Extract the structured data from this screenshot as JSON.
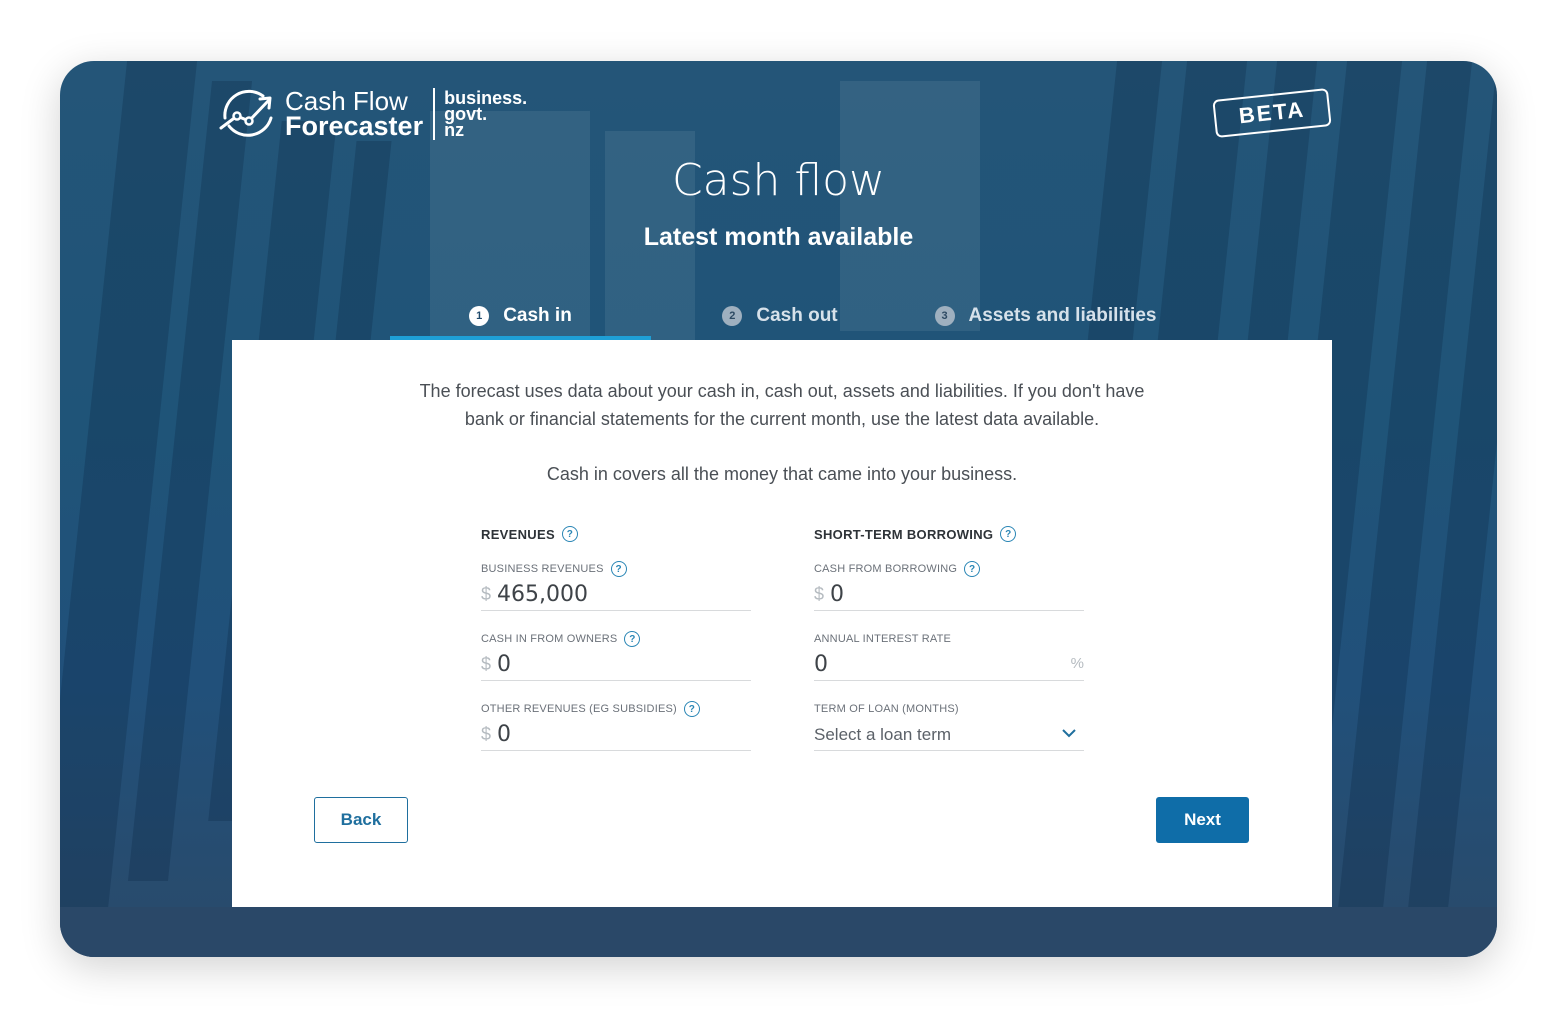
{
  "brand": {
    "logo_line1": "Cash Flow",
    "logo_line2": "Forecaster",
    "partner_line1": "business.",
    "partner_line2": "govt.",
    "partner_line3": "nz",
    "badge": "BETA"
  },
  "header": {
    "title": "Cash flow",
    "subtitle": "Latest month available"
  },
  "tabs": [
    {
      "num": "1",
      "label": "Cash in",
      "active": true
    },
    {
      "num": "2",
      "label": "Cash out",
      "active": false
    },
    {
      "num": "3",
      "label": "Assets and liabilities",
      "active": false
    }
  ],
  "intro": {
    "paragraph1": "The forecast uses data about your cash in, cash out, assets and liabilities. If you don't have bank or financial statements for the current month, use the latest data available.",
    "paragraph2": "Cash in covers all the money that came into your business."
  },
  "revenues": {
    "heading": "REVENUES",
    "fields": [
      {
        "label": "BUSINESS REVENUES",
        "currency": "$",
        "value": "465,000",
        "help": true
      },
      {
        "label": "CASH IN FROM OWNERS",
        "currency": "$",
        "value": "0",
        "help": true
      },
      {
        "label": "OTHER REVENUES (EG SUBSIDIES)",
        "currency": "$",
        "value": "0",
        "help": true
      }
    ]
  },
  "borrowing": {
    "heading": "SHORT-TERM BORROWING",
    "cash_from_borrowing": {
      "label": "CASH FROM BORROWING",
      "currency": "$",
      "value": "0"
    },
    "annual_interest_rate": {
      "label": "ANNUAL INTEREST RATE",
      "value": "0",
      "suffix": "%"
    },
    "term_of_loan": {
      "label": "TERM OF LOAN (MONTHS)",
      "placeholder": "Select a loan term"
    }
  },
  "help_glyph": "?",
  "actions": {
    "back": "Back",
    "next": "Next"
  },
  "colors": {
    "primary": "#0f6da8",
    "active_tab_underline": "#1e9fd6",
    "help_icon": "#2a86b5"
  }
}
